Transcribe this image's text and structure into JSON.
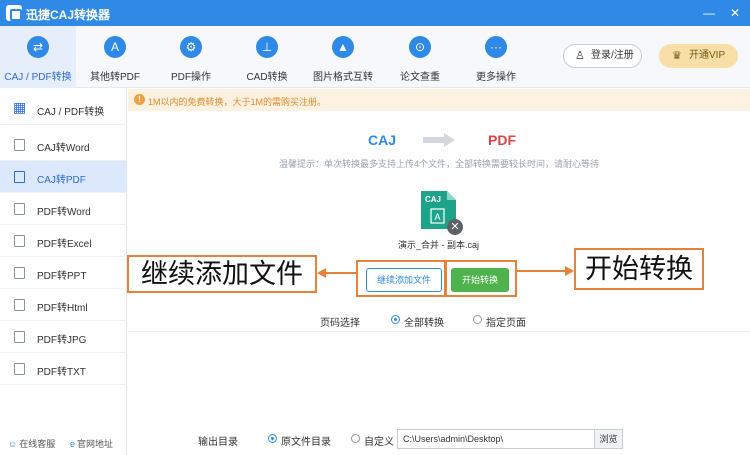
{
  "window": {
    "title": "迅捷CAJ转换器",
    "minimize": "—",
    "close": "✕"
  },
  "toolbar": {
    "items": [
      {
        "label": "CAJ / PDF转换",
        "icon": "swap-icon"
      },
      {
        "label": "其他转PDF",
        "icon": "pdf-icon"
      },
      {
        "label": "PDF操作",
        "icon": "gear-icon"
      },
      {
        "label": "CAD转换",
        "icon": "cad-icon"
      },
      {
        "label": "图片格式互转",
        "icon": "image-icon"
      },
      {
        "label": "论文查重",
        "icon": "search-doc-icon"
      },
      {
        "label": "更多操作",
        "icon": "more-icon"
      }
    ],
    "login": "登录/注册",
    "vip": "开通VIP"
  },
  "sidebar": {
    "items": [
      {
        "label": "CAJ / PDF转换"
      },
      {
        "label": "CAJ转Word"
      },
      {
        "label": "CAJ转PDF"
      },
      {
        "label": "PDF转Word"
      },
      {
        "label": "PDF转Excel"
      },
      {
        "label": "PDF转PPT"
      },
      {
        "label": "PDF转Html"
      },
      {
        "label": "PDF转JPG"
      },
      {
        "label": "PDF转TXT"
      }
    ],
    "service": "在线客服",
    "website": "官网地址"
  },
  "notice": "1M以内的免费转换，大于1M的需购买注册。",
  "conversion": {
    "from": "CAJ",
    "to": "PDF"
  },
  "tip": "温馨提示：单次转换最多支持上传4个文件，全部转换需要较长时间，请耐心等待",
  "file": {
    "name": "演示_合并 - 副本.caj",
    "badge": "CAJ",
    "glyph": "A"
  },
  "buttons": {
    "continue": "继续添加文件",
    "start": "开始转换"
  },
  "callouts": {
    "left": "继续添加文件",
    "right": "开始转换"
  },
  "pages": {
    "label": "页码选择",
    "all": "全部转换",
    "specify": "指定页面"
  },
  "output": {
    "label": "输出目录",
    "original": "原文件目录",
    "custom": "自定义",
    "path": "C:\\Users\\admin\\Desktop\\",
    "browse": "浏览"
  },
  "colors": {
    "accent": "#2e8ae6",
    "green": "#4fb34d",
    "callout_border": "#e8813a",
    "notice_text": "#e08a2b"
  }
}
